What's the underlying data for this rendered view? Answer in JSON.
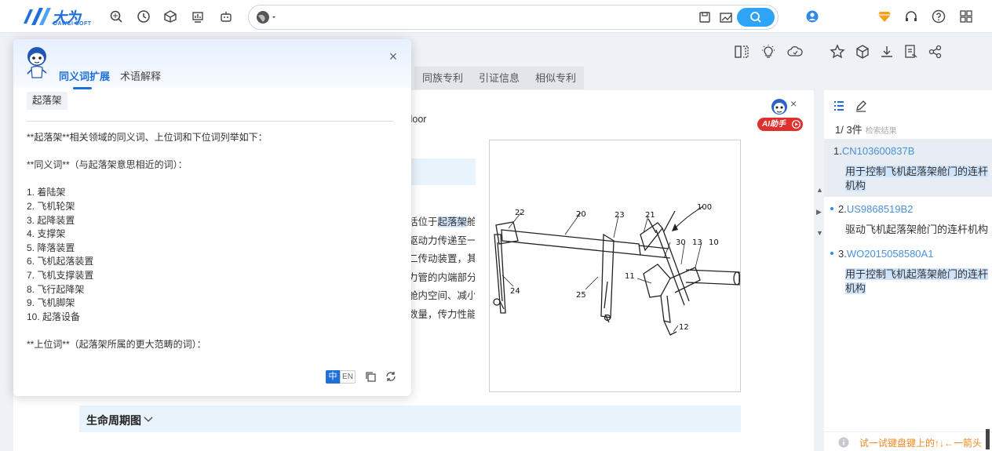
{
  "header": {
    "logo_text": "大为",
    "logo_sub": "DAWEI SOFT",
    "nav_icons": [
      "search-history-icon",
      "clock-icon",
      "cube-icon",
      "chart-icon",
      "robot-icon"
    ],
    "search": {
      "value": "",
      "placeholder": ""
    },
    "right_icons": [
      "user-icon",
      "vip-diamond-icon",
      "headset-icon",
      "help-icon",
      "grid-icon"
    ]
  },
  "doc_toolbar": {
    "icons": [
      "split-view-icon",
      "bulb-icon",
      "cloud-icon",
      "star-icon",
      "cube-icon",
      "download-icon",
      "export-icon",
      "share-icon"
    ]
  },
  "tabs": [
    "同族专利",
    "引证信息",
    "相似专利"
  ],
  "content": {
    "partial_title": "h door",
    "lines": [
      {
        "text": "括位于",
        "highlight": "起落架",
        "rest": "舱"
      },
      {
        "text": "驱动力传递至一"
      },
      {
        "text": "二传动装置，其"
      },
      {
        "text": "力管的内端部分"
      },
      {
        "text": "舱内空间、减小"
      },
      {
        "text": "数量，传力性能"
      }
    ],
    "ai_helper_label": "AI助手",
    "lifecycle_label": "生命周期图"
  },
  "figure": {
    "labels": [
      "22",
      "20",
      "23",
      "21",
      "100",
      "30",
      "13",
      "10",
      "11",
      "24",
      "25",
      "12"
    ]
  },
  "popup": {
    "tabs": [
      "同义词扩展",
      "术语解释"
    ],
    "active_tab": "同义词扩展",
    "chip": "起落架",
    "body": [
      "**起落架**相关领域的同义词、上位词和下位词列举如下：",
      "",
      "**同义词**（与起落架意思相近的词）：",
      "",
      "1. 着陆架",
      "2. 飞机轮架",
      "3. 起降装置",
      "4. 支撑架",
      "5. 降落装置",
      "6. 飞机起落装置",
      "7. 飞机支撑装置",
      "8. 飞行起降架",
      "9. 飞机脚架",
      "10. 起落设备",
      "",
      "**上位词**（起落架所属的更大范畴的词）："
    ],
    "lang_zh": "中",
    "lang_en": "EN"
  },
  "results": {
    "count_label": "1/ 3件",
    "count_sub": "检索结果",
    "items": [
      {
        "index": "1.",
        "id": "CN103600837B",
        "title": "用于控制飞机起落架舱门的连杆机构"
      },
      {
        "index": "2.",
        "id": "US9868519B2",
        "title": "驱动飞机起落架舱门的连杆机构"
      },
      {
        "index": "3.",
        "id": "WO2015058580A1",
        "title": "用于控制飞机起落架舱门的连杆机构"
      }
    ],
    "hint": "试一试键盘键上的↑↓←一箭头"
  },
  "colors": {
    "brand": "#1e6fd9",
    "accent_search": "#2da4f5",
    "highlight": "#cfe3fb",
    "hint": "#ef8a1f"
  }
}
